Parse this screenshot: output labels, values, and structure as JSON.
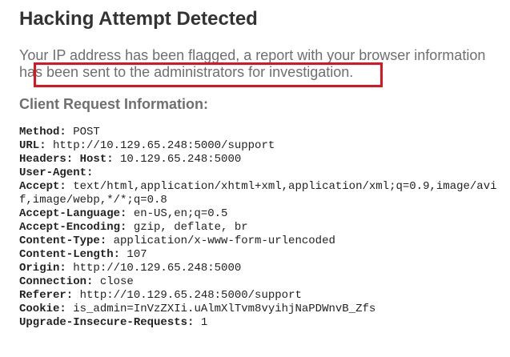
{
  "page": {
    "title": "Hacking Attempt Detected",
    "message": "Your IP address has been flagged, a report with your browser information has been sent to the administrators for investigation.",
    "section_title": "Client Request Information:"
  },
  "colors": {
    "highlight_box": "#e0141e",
    "message_text": "#6f6f6f",
    "title_text": "#333333"
  },
  "request_info": [
    {
      "key": "Method:",
      "value": " POST"
    },
    {
      "key": "URL:",
      "value": " http://10.129.65.248:5000/support"
    },
    {
      "key": "Headers: Host:",
      "value": " 10.129.65.248:5000"
    },
    {
      "key": "User-Agent:",
      "value": ""
    },
    {
      "key": "Accept:",
      "value": " text/html,application/xhtml+xml,application/xml;q=0.9,image/avif,image/webp,*/*;q=0.8"
    },
    {
      "key": "Accept-Language:",
      "value": " en-US,en;q=0.5"
    },
    {
      "key": "Accept-Encoding:",
      "value": " gzip, deflate, br"
    },
    {
      "key": "Content-Type:",
      "value": " application/x-www-form-urlencoded"
    },
    {
      "key": "Content-Length:",
      "value": " 107"
    },
    {
      "key": "Origin:",
      "value": " http://10.129.65.248:5000"
    },
    {
      "key": "Connection:",
      "value": " close"
    },
    {
      "key": "Referer:",
      "value": " http://10.129.65.248:5000/support"
    },
    {
      "key": "Cookie:",
      "value": " is_admin=InVzZXIi.uAlmXlTvm8vyihjNaPDWnvB_Zfs"
    },
    {
      "key": "Upgrade-Insecure-Requests:",
      "value": " 1"
    }
  ]
}
